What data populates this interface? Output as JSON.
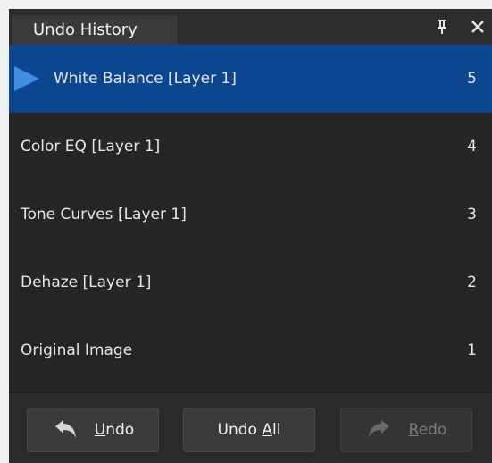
{
  "panel": {
    "title": "Undo History",
    "pin_icon": "pin-icon",
    "close_icon": "close-icon"
  },
  "history": [
    {
      "label": "White Balance [Layer 1]",
      "number": "5",
      "selected": true
    },
    {
      "label": "Color EQ [Layer 1]",
      "number": "4",
      "selected": false
    },
    {
      "label": "Tone Curves [Layer 1]",
      "number": "3",
      "selected": false
    },
    {
      "label": "Dehaze [Layer 1]",
      "number": "2",
      "selected": false
    },
    {
      "label": "Original Image",
      "number": "1",
      "selected": false
    }
  ],
  "buttons": {
    "undo": {
      "text": "Undo",
      "mnemonic": "U",
      "rest": "ndo",
      "icon": "undo-arrow-icon",
      "enabled": true
    },
    "undo_all": {
      "text": "Undo All",
      "prefix": "Undo ",
      "mnemonic": "A",
      "rest": "ll",
      "enabled": true
    },
    "redo": {
      "text": "Redo",
      "mnemonic": "R",
      "rest": "edo",
      "icon": "redo-arrow-icon",
      "enabled": false
    }
  },
  "colors": {
    "selected_row": "#0c4690",
    "marker": "#3d8fe0",
    "panel_bg": "#252525"
  }
}
